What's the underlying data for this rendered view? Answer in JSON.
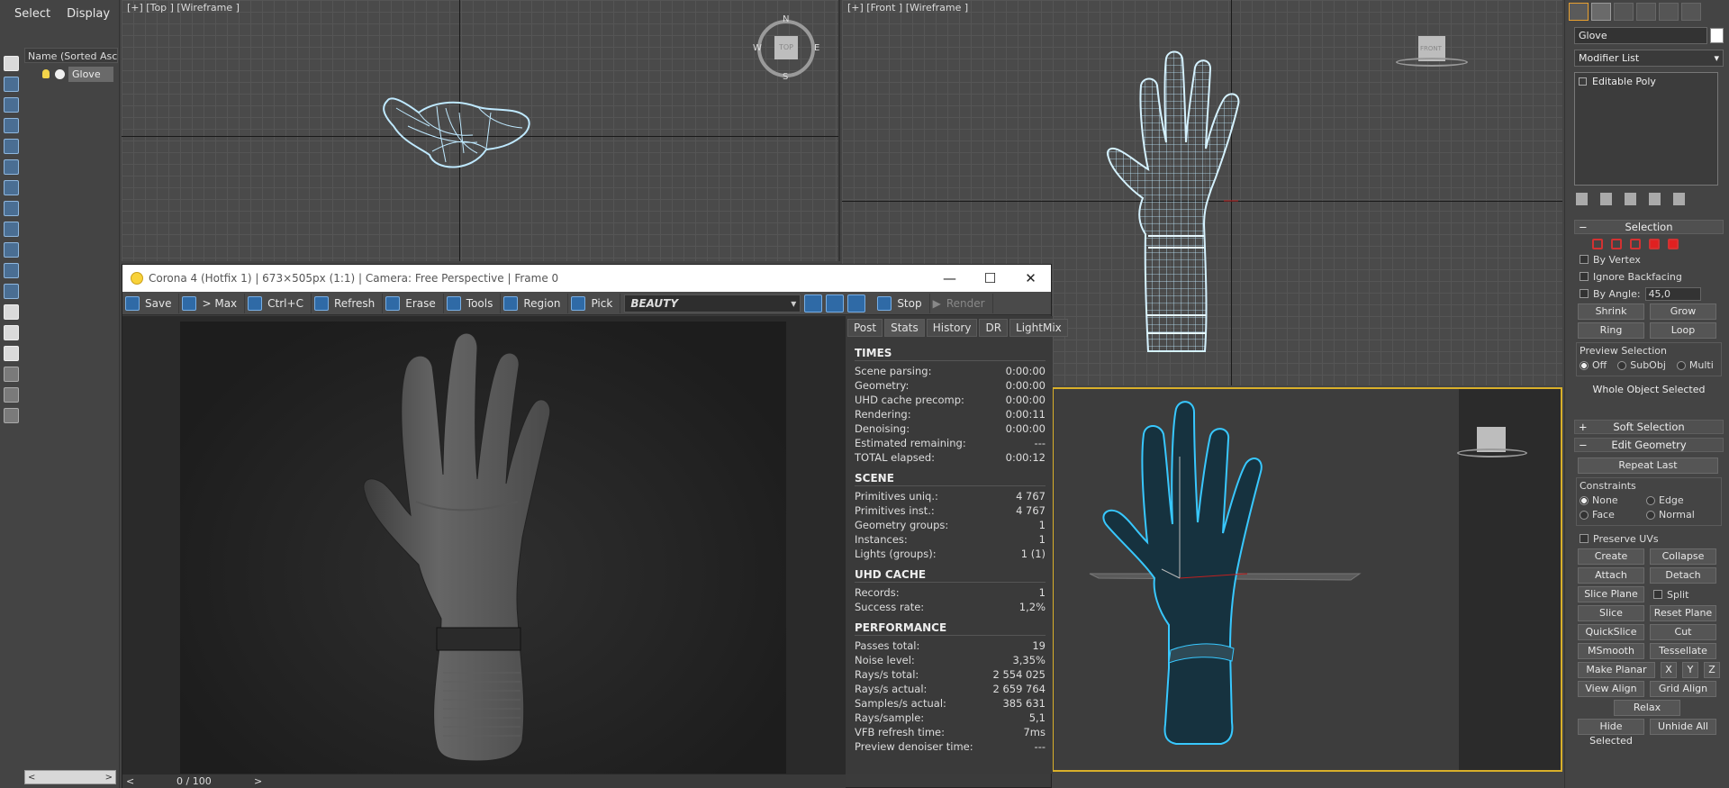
{
  "explorer": {
    "menu": [
      "Select",
      "Display"
    ],
    "column_header": "Name (Sorted Ascending)",
    "object_row": "Glove",
    "scroll_left": "<",
    "scroll_right": ">"
  },
  "viewports": {
    "top_label": "[+] [Top ] [Wireframe ]",
    "front_label": "[+] [Front ] [Wireframe ]",
    "compass": {
      "n": "N",
      "s": "S",
      "e": "E",
      "w": "W",
      "cube": "TOP"
    },
    "front_cube": "FRONT"
  },
  "vfb": {
    "title": "Corona 4 (Hotfix 1) | 673×505px (1:1) | Camera: Free Perspective | Frame 0",
    "window_buttons": {
      "minimize": "—",
      "maximize": "☐",
      "close": "✕"
    },
    "toolbar": {
      "save": "Save",
      "to_max": "> Max",
      "copy": "Ctrl+C",
      "refresh": "Refresh",
      "erase": "Erase",
      "tools": "Tools",
      "region": "Region",
      "pick": "Pick",
      "channel": "BEAUTY",
      "stop": "Stop",
      "render": "Render"
    },
    "stats_tabs": [
      "Post",
      "Stats",
      "History",
      "DR",
      "LightMix"
    ],
    "active_tab": "Stats",
    "sections": {
      "times": {
        "title": "TIMES",
        "rows": [
          [
            "Scene parsing:",
            "0:00:00"
          ],
          [
            "Geometry:",
            "0:00:00"
          ],
          [
            "UHD cache precomp:",
            "0:00:00"
          ],
          [
            "Rendering:",
            "0:00:11"
          ],
          [
            "Denoising:",
            "0:00:00"
          ],
          [
            "Estimated remaining:",
            "---"
          ],
          [
            "TOTAL elapsed:",
            "0:00:12"
          ]
        ]
      },
      "scene": {
        "title": "SCENE",
        "rows": [
          [
            "Primitives uniq.:",
            "4 767"
          ],
          [
            "Primitives inst.:",
            "4 767"
          ],
          [
            "Geometry groups:",
            "1"
          ],
          [
            "Instances:",
            "1"
          ],
          [
            "Lights (groups):",
            "1 (1)"
          ]
        ]
      },
      "uhd": {
        "title": "UHD CACHE",
        "rows": [
          [
            "Records:",
            "1"
          ],
          [
            "Success rate:",
            "1,2%"
          ]
        ]
      },
      "performance": {
        "title": "PERFORMANCE",
        "rows": [
          [
            "Passes total:",
            "19"
          ],
          [
            "Noise level:",
            "3,35%"
          ],
          [
            "Rays/s total:",
            "2 554 025"
          ],
          [
            "Rays/s actual:",
            "2 659 764"
          ],
          [
            "Samples/s actual:",
            "385 631"
          ],
          [
            "Rays/sample:",
            "5,1"
          ],
          [
            "VFB refresh time:",
            "7ms"
          ],
          [
            "Preview denoiser time:",
            "---"
          ]
        ]
      }
    },
    "pager": {
      "prev": "<",
      "value": "0 / 100",
      "next": ">"
    }
  },
  "command_panel": {
    "object_name": "Glove",
    "modifier_list": "Modifier List",
    "stack_item": "Editable Poly",
    "selection": {
      "title": "Selection",
      "by_vertex": "By Vertex",
      "ignore_backfacing": "Ignore Backfacing",
      "by_angle": "By Angle:",
      "angle_value": "45,0",
      "shrink": "Shrink",
      "grow": "Grow",
      "ring": "Ring",
      "loop": "Loop",
      "preview_title": "Preview Selection",
      "preview_off": "Off",
      "preview_subobj": "SubObj",
      "preview_multi": "Multi",
      "status": "Whole Object Selected"
    },
    "soft_selection": "Soft Selection",
    "edit_geometry": {
      "title": "Edit Geometry",
      "repeat_last": "Repeat Last",
      "constraints_title": "Constraints",
      "none": "None",
      "edge": "Edge",
      "face": "Face",
      "normal": "Normal",
      "preserve_uvs": "Preserve UVs",
      "create": "Create",
      "collapse": "Collapse",
      "attach": "Attach",
      "detach": "Detach",
      "slice_plane": "Slice Plane",
      "split": "Split",
      "slice": "Slice",
      "reset_plane": "Reset Plane",
      "quickslice": "QuickSlice",
      "cut": "Cut",
      "msmooth": "MSmooth",
      "tessellate": "Tessellate",
      "make_planar": "Make Planar",
      "x": "X",
      "y": "Y",
      "z": "Z",
      "view_align": "View Align",
      "grid_align": "Grid Align",
      "relax": "Relax",
      "hide_selected": "Hide Selected",
      "unhide_all": "Unhide All"
    }
  },
  "colors": {
    "wire": "#bfe9ff",
    "selection_outline": "#38c8ff",
    "active_viewport": "#d9b02a",
    "vfb_icon": "#2f6aa6"
  }
}
